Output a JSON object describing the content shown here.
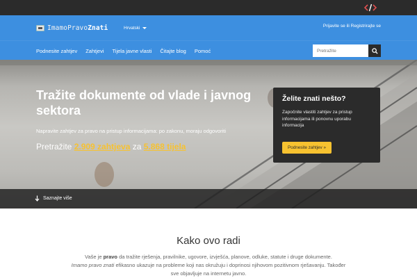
{
  "topbar": {
    "icon": "code-icon",
    "accent": "#e05050"
  },
  "header": {
    "logo_text_a": "ImamoPravo",
    "logo_text_b": "Znati",
    "language": "Hrvatski",
    "auth_link": "Prijavite se ili Registrirajte se",
    "bg_color": "#3d8fe0"
  },
  "nav": {
    "items": [
      {
        "label": "Podnesite zahtjev"
      },
      {
        "label": "Zahtjevi"
      },
      {
        "label": "Tijela javne vlasti"
      },
      {
        "label": "Čitajte blog"
      },
      {
        "label": "Pomoć"
      }
    ],
    "search_placeholder": "Pretražite"
  },
  "hero": {
    "title": "Tražite dokumente od vlade i javnog sektora",
    "subtitle": "Napravite zahtjev za pravo na pristup informacijama: po zakonu, moraju odgovoriti",
    "stats_prefix": "Pretražite ",
    "requests_count": "2.909 zahtjeva",
    "stats_mid": " za ",
    "bodies_count": "5.868 tijela",
    "highlight_color": "#f7c230",
    "more_label": "Saznajte više"
  },
  "card": {
    "title": "Želite znati nešto?",
    "text": "Započnite vlastiti zahtjev za pristup informacijama ili ponovnu uporabu informacija",
    "button": "Podnesite zahtjev »"
  },
  "how": {
    "title": "Kako ovo radi",
    "line1_a": "Vaše je ",
    "line1_b": "pravo",
    "line1_c": " da tražite rješenja, pravilnike, ugovore, izvješća, planove, odluke, statute i druge dokumente.",
    "line2_a": "Imamo pravo znati",
    "line2_b": " efikasno ukazuje na probleme koji nas okružuju i doprinosi njihovom pozitivnom rješavanju. Također sve objavljuje na internetu javno."
  }
}
